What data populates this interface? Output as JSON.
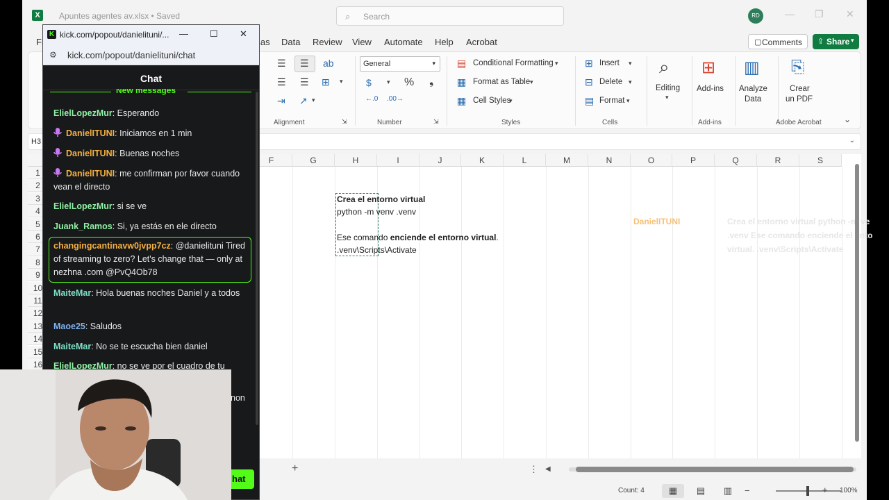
{
  "excel": {
    "doc_title": "Apuntes agentes av.xlsx • Saved",
    "search_placeholder": "Search",
    "avatar_initials": "RD",
    "menu": [
      "Fi",
      "las",
      "Data",
      "Review",
      "View",
      "Automate",
      "Help",
      "Acrobat"
    ],
    "comments_label": "Comments",
    "share_label": "Share",
    "ribbon": {
      "alignment_label": "Alignment",
      "number_label": "Number",
      "number_format": "General",
      "conditional_formatting": "Conditional Formatting",
      "format_as_table": "Format as Table",
      "cell_styles": "Cell Styles",
      "styles_label": "Styles",
      "insert": "Insert",
      "delete": "Delete",
      "format": "Format",
      "cells_label": "Cells",
      "editing": "Editing",
      "addins": "Add-ins",
      "addins_group": "Add-ins",
      "analyze_data_1": "Analyze",
      "analyze_data_2": "Data",
      "create_pdf_1": "Crear",
      "create_pdf_2": "un PDF",
      "adobe_acrobat": "Adobe Acrobat"
    },
    "name_box": "H3",
    "columns": [
      "F",
      "G",
      "H",
      "I",
      "J",
      "K",
      "L",
      "M",
      "N",
      "O",
      "P",
      "Q",
      "R",
      "S"
    ],
    "rows": [
      "1",
      "2",
      "3",
      "4",
      "5",
      "6",
      "7",
      "8",
      "9",
      "10",
      "11",
      "12",
      "13",
      "14",
      "15",
      "16"
    ],
    "cells": {
      "h3": "Crea el entorno virtual",
      "h4": "python -m venv .venv",
      "h6_prefix": "Ese comando ",
      "h6_bold": "enciende el entorno virtual",
      "h6_suffix": ".",
      "h7": ".venv\\Scripts\\Activate"
    },
    "overlay": {
      "name": "DanielITUNI",
      "line1": "Crea el entorno virtual python -m ve",
      "line2": ".venv Ese comando enciende el ento",
      "line3": "virtual. .venv\\Scripts\\Activate"
    },
    "status": {
      "count": "Count: 4",
      "zoom": "100%"
    }
  },
  "popout": {
    "window_title": "kick.com/popout/danielituni/...",
    "url": "kick.com/popout/danielituni/chat",
    "chat_title": "Chat",
    "new_messages": "New messages",
    "messages": [
      {
        "user": "ElielLopezMur",
        "text": ": Esperando",
        "color": "#8ff0a4",
        "mic": false
      },
      {
        "user": "DanielITUNI",
        "text": ": Iniciamos en 1 min",
        "color": "#f5b041",
        "mic": true
      },
      {
        "user": "DanielITUNI",
        "text": ": Buenas noches",
        "color": "#f5b041",
        "mic": true
      },
      {
        "user": "DanielITUNI",
        "text": ": me confirman por favor cuando vean el directo",
        "color": "#f5b041",
        "mic": true
      },
      {
        "user": "ElielLopezMur",
        "text": ": si se ve",
        "color": "#8ff0a4",
        "mic": false
      },
      {
        "user": "Juank_Ramos",
        "text": ": Si, ya estás en ele directo",
        "color": "#8ff0a4",
        "mic": false
      },
      {
        "user": "changingcantinavw0jvpp7cz",
        "text": ": @danielituni Tired of streaming to zero? Let's change that — only at nezhna .com @PvQ4Ob78",
        "color": "#f5b041",
        "mic": false
      },
      {
        "user": "MaiteMar",
        "text": ": Hola buenas noches Daniel y a todos",
        "color": "#7ee0c8",
        "mic": false
      },
      {
        "user": "Maoe25",
        "text": ": Saludos",
        "color": "#7fb2f0",
        "mic": false
      },
      {
        "user": "MaiteMar",
        "text": ": No se te escucha bien daniel",
        "color": "#7ee0c8",
        "mic": false
      },
      {
        "user": "ElielLopezMur",
        "text": ": no se ve por el cuadro de tu",
        "color": "#8ff0a4",
        "mic": false
      }
    ],
    "partial_text": "non",
    "chat_button": "hat",
    "accent": "#53fc18"
  }
}
